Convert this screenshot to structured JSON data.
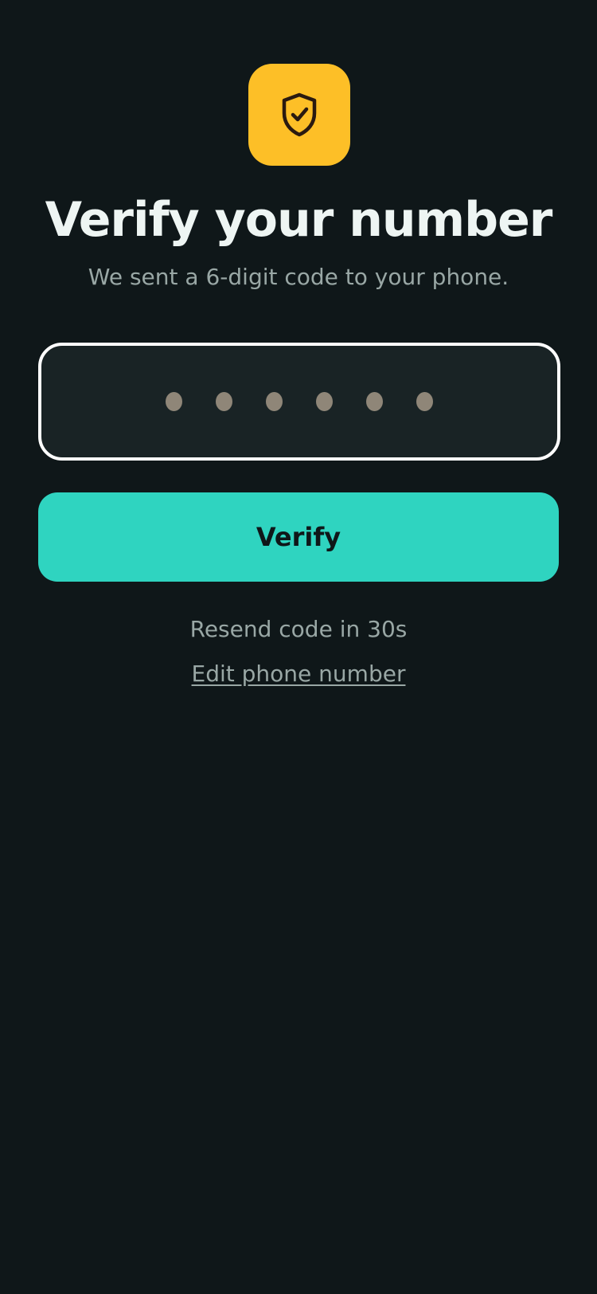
{
  "header": {
    "icon": "shield-check-icon",
    "title": "Verify your number",
    "subtitle": "We sent a 6-digit code to your phone."
  },
  "code_input": {
    "digit_count": 6,
    "entered_digits": 0,
    "placeholder_glyph": "•"
  },
  "actions": {
    "verify_label": "Verify",
    "resend_text": "Resend code in 30s",
    "edit_phone_label": "Edit phone number"
  },
  "colors": {
    "background": "#0f1719",
    "accent": "#2fd4c0",
    "badge": "#fdbf27",
    "title": "#eef5f3",
    "muted_text": "#99a7a5",
    "input_fill": "#192325",
    "input_border": "#ffffff",
    "placeholder_dot": "#8f8678"
  }
}
